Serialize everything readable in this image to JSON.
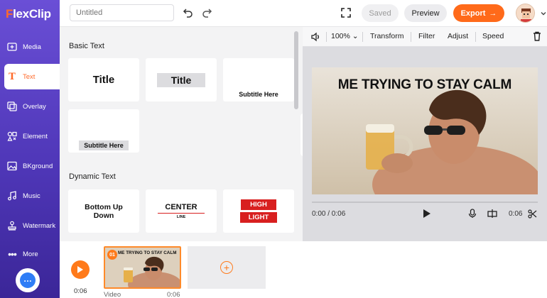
{
  "app": {
    "logo_prefix": "F",
    "logo_rest": "lexClip"
  },
  "sidebar": {
    "items": [
      {
        "label": "Media",
        "icon": "media-icon"
      },
      {
        "label": "Text",
        "icon": "text-icon"
      },
      {
        "label": "Overlay",
        "icon": "overlay-icon"
      },
      {
        "label": "Element",
        "icon": "element-icon"
      },
      {
        "label": "BKground",
        "icon": "background-icon"
      },
      {
        "label": "Music",
        "icon": "music-icon"
      },
      {
        "label": "Watermark",
        "icon": "watermark-icon"
      },
      {
        "label": "More",
        "icon": "more-icon"
      }
    ],
    "active": "Text"
  },
  "topbar": {
    "title_placeholder": "Untitled",
    "saved_label": "Saved",
    "preview_label": "Preview",
    "export_label": "Export"
  },
  "panel": {
    "basic_heading": "Basic Text",
    "dynamic_heading": "Dynamic Text",
    "basic_cards": [
      "Title",
      "Title",
      "Subtitle Here",
      "Subtitle Here"
    ],
    "dynamic_cards": [
      {
        "line1": "Bottom Up",
        "line2": "Down"
      },
      {
        "line1": "CENTER",
        "line2": "LINE"
      },
      {
        "line1": "HIGH",
        "line2": "LIGHT"
      }
    ]
  },
  "toolbar": {
    "zoom": "100%",
    "transform": "Transform",
    "filter": "Filter",
    "adjust": "Adjust",
    "speed": "Speed"
  },
  "preview": {
    "caption": "ME TRYING TO STAY CALM",
    "time_current": "0:00 / 0:06",
    "time_duration": "0:06"
  },
  "timeline": {
    "time": "0:06",
    "clip_number": "01",
    "clip_caption": "ME TRYING TO STAY CALM",
    "clip_label": "Video",
    "clip_duration": "0:06"
  },
  "colors": {
    "accent": "#ff6a1a",
    "sidebar": "#5a41c8",
    "highlight_red": "#d81f1f"
  }
}
